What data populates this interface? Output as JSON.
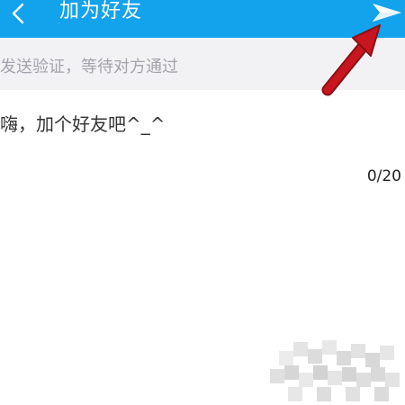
{
  "header": {
    "title": "加为好友",
    "back_icon": "chevron-left-icon",
    "send_icon": "send-paper-plane-icon",
    "background_color": "#13a2ec"
  },
  "hint": {
    "text": "发送验证，等待对方通过"
  },
  "message": {
    "value": "嗨，加个好友吧^_^",
    "counter": "0/20"
  },
  "annotation": {
    "arrow_color": "#c8161e"
  }
}
